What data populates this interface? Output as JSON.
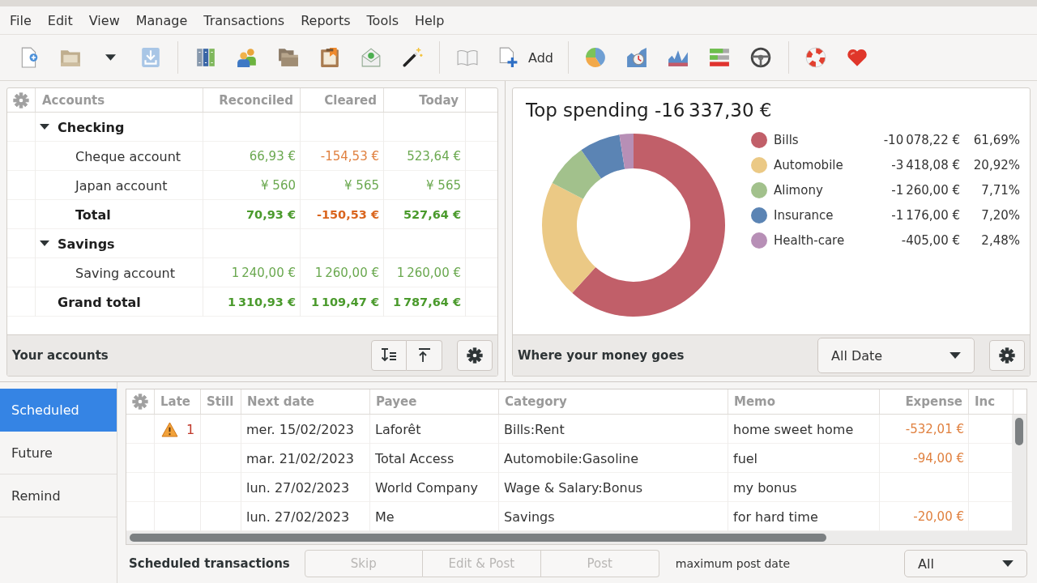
{
  "menu": [
    "File",
    "Edit",
    "View",
    "Manage",
    "Transactions",
    "Reports",
    "Tools",
    "Help"
  ],
  "toolbar": {
    "add_label": "Add"
  },
  "accounts": {
    "columns": [
      "Accounts",
      "Reconciled",
      "Cleared",
      "Today"
    ],
    "rows": [
      {
        "kind": "group",
        "label": "Checking",
        "expanded": true,
        "children": [
          {
            "kind": "account",
            "label": "Cheque account",
            "amounts": [
              {
                "text": "66,93 €",
                "negative": false
              },
              {
                "text": "-154,53 €",
                "negative": true
              },
              {
                "text": "523,64 €",
                "negative": false
              }
            ]
          },
          {
            "kind": "account",
            "label": "Japan account",
            "amounts": [
              {
                "text": "¥ 560",
                "negative": false
              },
              {
                "text": "¥ 565",
                "negative": false
              },
              {
                "text": "¥ 565",
                "negative": false
              }
            ]
          },
          {
            "kind": "total",
            "label": "Total",
            "amounts": [
              {
                "text": "70,93 €",
                "negative": false
              },
              {
                "text": "-150,53 €",
                "negative": true
              },
              {
                "text": "527,64 €",
                "negative": false
              }
            ]
          }
        ]
      },
      {
        "kind": "group",
        "label": "Savings",
        "expanded": true,
        "children": [
          {
            "kind": "account",
            "label": "Saving account",
            "amounts": [
              {
                "text": "1 240,00 €",
                "negative": false
              },
              {
                "text": "1 260,00 €",
                "negative": false
              },
              {
                "text": "1 260,00 €",
                "negative": false
              }
            ]
          }
        ]
      },
      {
        "kind": "grand_total",
        "label": "Grand total",
        "amounts": [
          {
            "text": "1 310,93 €",
            "negative": false
          },
          {
            "text": "1 109,47 €",
            "negative": false
          },
          {
            "text": "1 787,64 €",
            "negative": false
          }
        ]
      }
    ],
    "footer_title": "Your accounts"
  },
  "spending": {
    "chart_data": {
      "type": "donut",
      "title": "Top spending -16 337,30 €",
      "categories": [
        "Bills",
        "Automobile",
        "Alimony",
        "Insurance",
        "Health-care"
      ],
      "values": [
        61.69,
        20.92,
        7.71,
        7.2,
        2.48
      ],
      "legend": "right"
    },
    "legend_entries": [
      {
        "amount": "-10 078,22 €",
        "percent": "61,69%",
        "color": "#c15f69"
      },
      {
        "amount": "-3 418,08 €",
        "percent": "20,92%",
        "color": "#ebc985"
      },
      {
        "amount": "-1 260,00 €",
        "percent": "7,71%",
        "color": "#a2c18c"
      },
      {
        "amount": "-1 176,00 €",
        "percent": "7,20%",
        "color": "#5b84b4"
      },
      {
        "amount": "-405,00 €",
        "percent": "2,48%",
        "color": "#b78fb6"
      }
    ],
    "footer_title": "Where your money goes",
    "date_filter": "All Date"
  },
  "schedule_tabs": [
    {
      "label": "Scheduled",
      "selected": true
    },
    {
      "label": "Future",
      "selected": false
    },
    {
      "label": "Remind",
      "selected": false
    }
  ],
  "scheduled": {
    "columns": [
      "Late",
      "Still",
      "Next date",
      "Payee",
      "Category",
      "Memo",
      "Expense",
      "Inc"
    ],
    "rows": [
      {
        "warning": true,
        "late": "1",
        "next_date": "mer. 15/02/2023",
        "payee": "Laforêt",
        "category": "Bills:Rent",
        "memo": "home sweet home",
        "expense": "-532,01 €"
      },
      {
        "warning": false,
        "next_date": "mar. 21/02/2023",
        "payee": "Total Access",
        "category": "Automobile:Gasoline",
        "memo": "fuel",
        "expense": "-94,00 €"
      },
      {
        "warning": false,
        "next_date": "lun. 27/02/2023",
        "payee": "World Company",
        "category": "Wage & Salary:Bonus",
        "memo": "my bonus"
      },
      {
        "warning": false,
        "next_date": "lun. 27/02/2023",
        "payee": "Me",
        "category": "Savings",
        "memo": "for hard time",
        "expense": "-20,00 €"
      }
    ],
    "footer_title": "Scheduled transactions",
    "actions": [
      {
        "label": "Skip",
        "disabled": true
      },
      {
        "label": "Edit & Post",
        "disabled": true
      },
      {
        "label": "Post",
        "disabled": true
      }
    ],
    "max_post_date_label": "maximum post date",
    "max_post_date": "All"
  }
}
